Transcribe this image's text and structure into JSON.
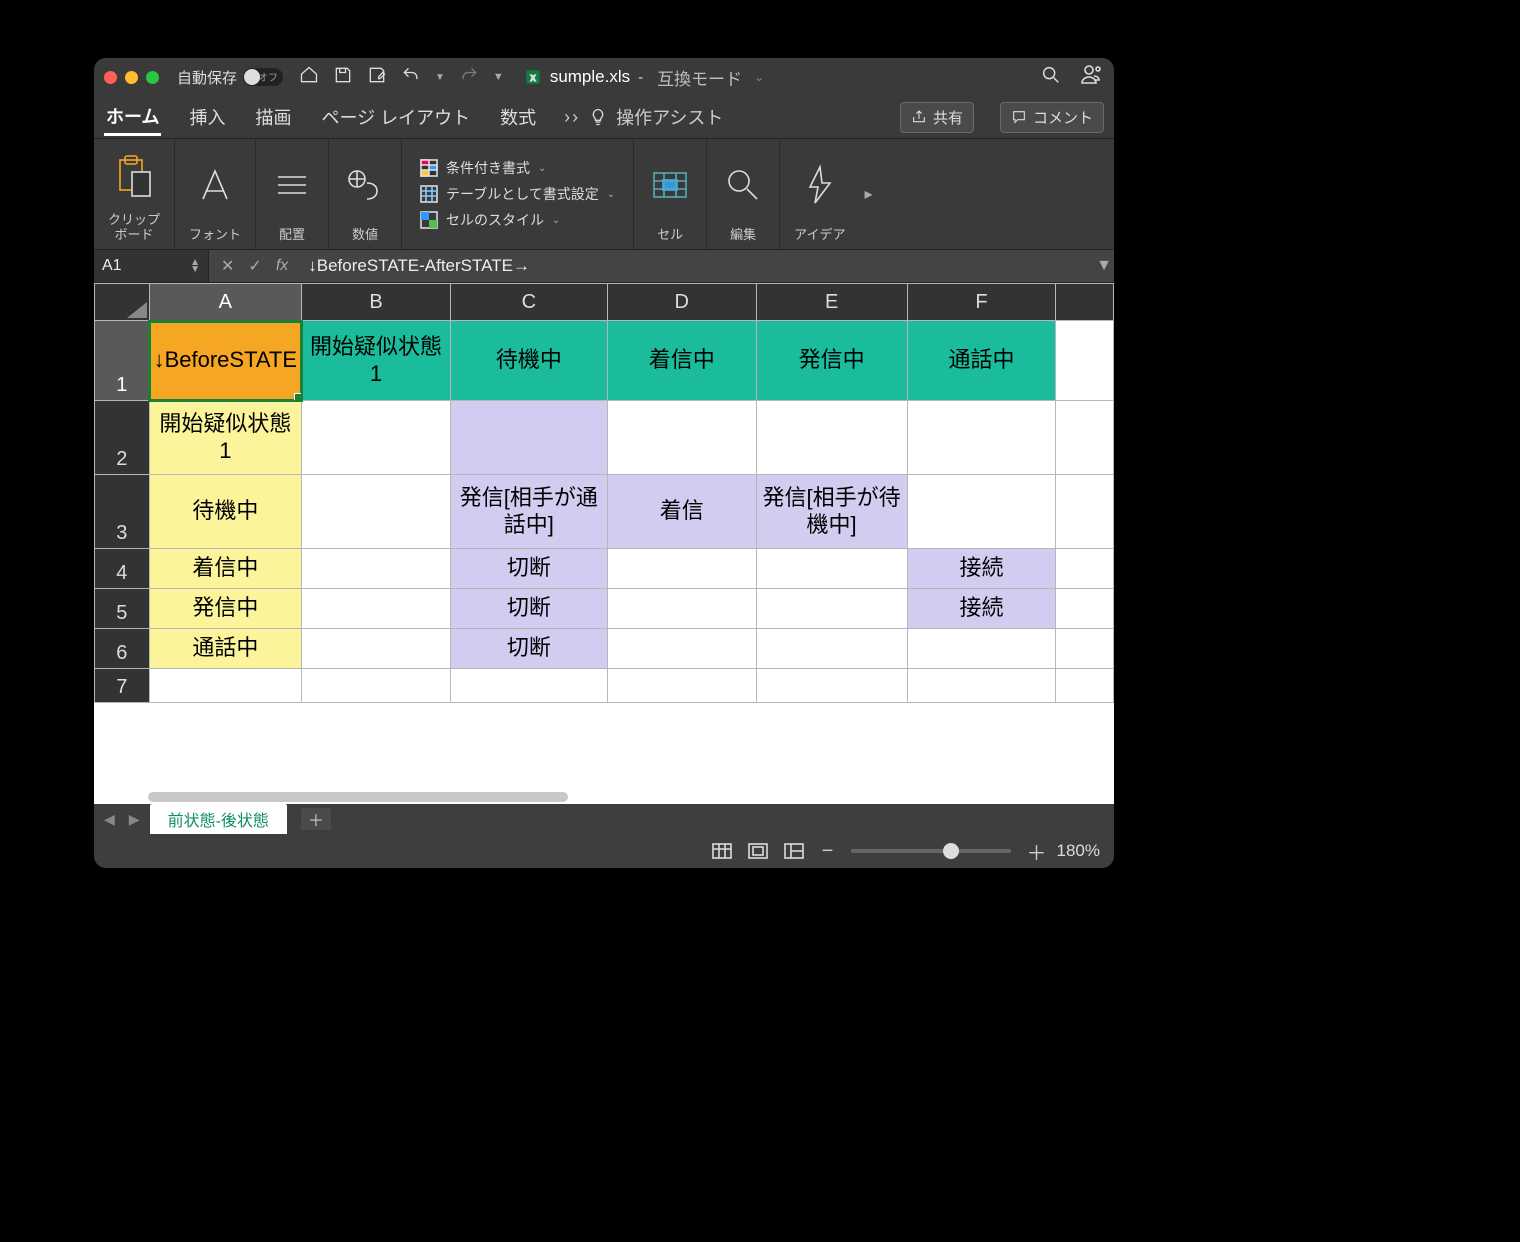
{
  "titlebar": {
    "autosave_label": "自動保存",
    "autosave_state": "オフ",
    "filename": "sumple.xls",
    "compat_mode": "互換モード"
  },
  "ribbon_tabs": {
    "home": "ホーム",
    "insert": "挿入",
    "draw": "描画",
    "layout": "ページ レイアウト",
    "formulas": "数式",
    "assist": "操作アシスト",
    "share": "共有",
    "comment": "コメント"
  },
  "ribbon_groups": {
    "clipboard": "クリップ\nボード",
    "font": "フォント",
    "alignment": "配置",
    "number": "数値",
    "cond_format": "条件付き書式",
    "as_table": "テーブルとして書式設定",
    "cell_styles": "セルのスタイル",
    "cells": "セル",
    "editing": "編集",
    "ideas": "アイデア"
  },
  "formula_bar": {
    "name_box": "A1",
    "fx": "fx",
    "content": "↓BeforeSTATE-AfterSTATE→"
  },
  "columns": [
    "A",
    "B",
    "C",
    "D",
    "E",
    "F"
  ],
  "rows": [
    "1",
    "2",
    "3",
    "4",
    "5",
    "6",
    "7"
  ],
  "cells": {
    "A1": "↓BeforeSTATE",
    "B1": "開始疑似状態1",
    "C1": "待機中",
    "D1": "着信中",
    "E1": "発信中",
    "F1": "通話中",
    "A2": "開始疑似状態1",
    "A3": "待機中",
    "C3": "発信[相手が通話中]",
    "D3": "着信",
    "E3": "発信[相手が待機中]",
    "A4": "着信中",
    "C4": "切断",
    "F4": "接続",
    "A5": "発信中",
    "C5": "切断",
    "F5": "接続",
    "A6": "通話中",
    "C6": "切断"
  },
  "sheet_tabs": {
    "tab1": "前状態-後状態"
  },
  "status": {
    "zoom": "180%"
  },
  "chart_data": {
    "type": "table",
    "title": "↓BeforeSTATE-AfterSTATE→",
    "columns": [
      "",
      "開始疑似状態1",
      "待機中",
      "着信中",
      "発信中",
      "通話中"
    ],
    "rows": [
      {
        "label": "開始疑似状態1",
        "cells": [
          "",
          "",
          "",
          "",
          ""
        ]
      },
      {
        "label": "待機中",
        "cells": [
          "",
          "発信[相手が通話中]",
          "着信",
          "発信[相手が待機中]",
          ""
        ]
      },
      {
        "label": "着信中",
        "cells": [
          "",
          "切断",
          "",
          "",
          "接続"
        ]
      },
      {
        "label": "発信中",
        "cells": [
          "",
          "切断",
          "",
          "",
          "接続"
        ]
      },
      {
        "label": "通話中",
        "cells": [
          "",
          "切断",
          "",
          "",
          ""
        ]
      }
    ]
  }
}
